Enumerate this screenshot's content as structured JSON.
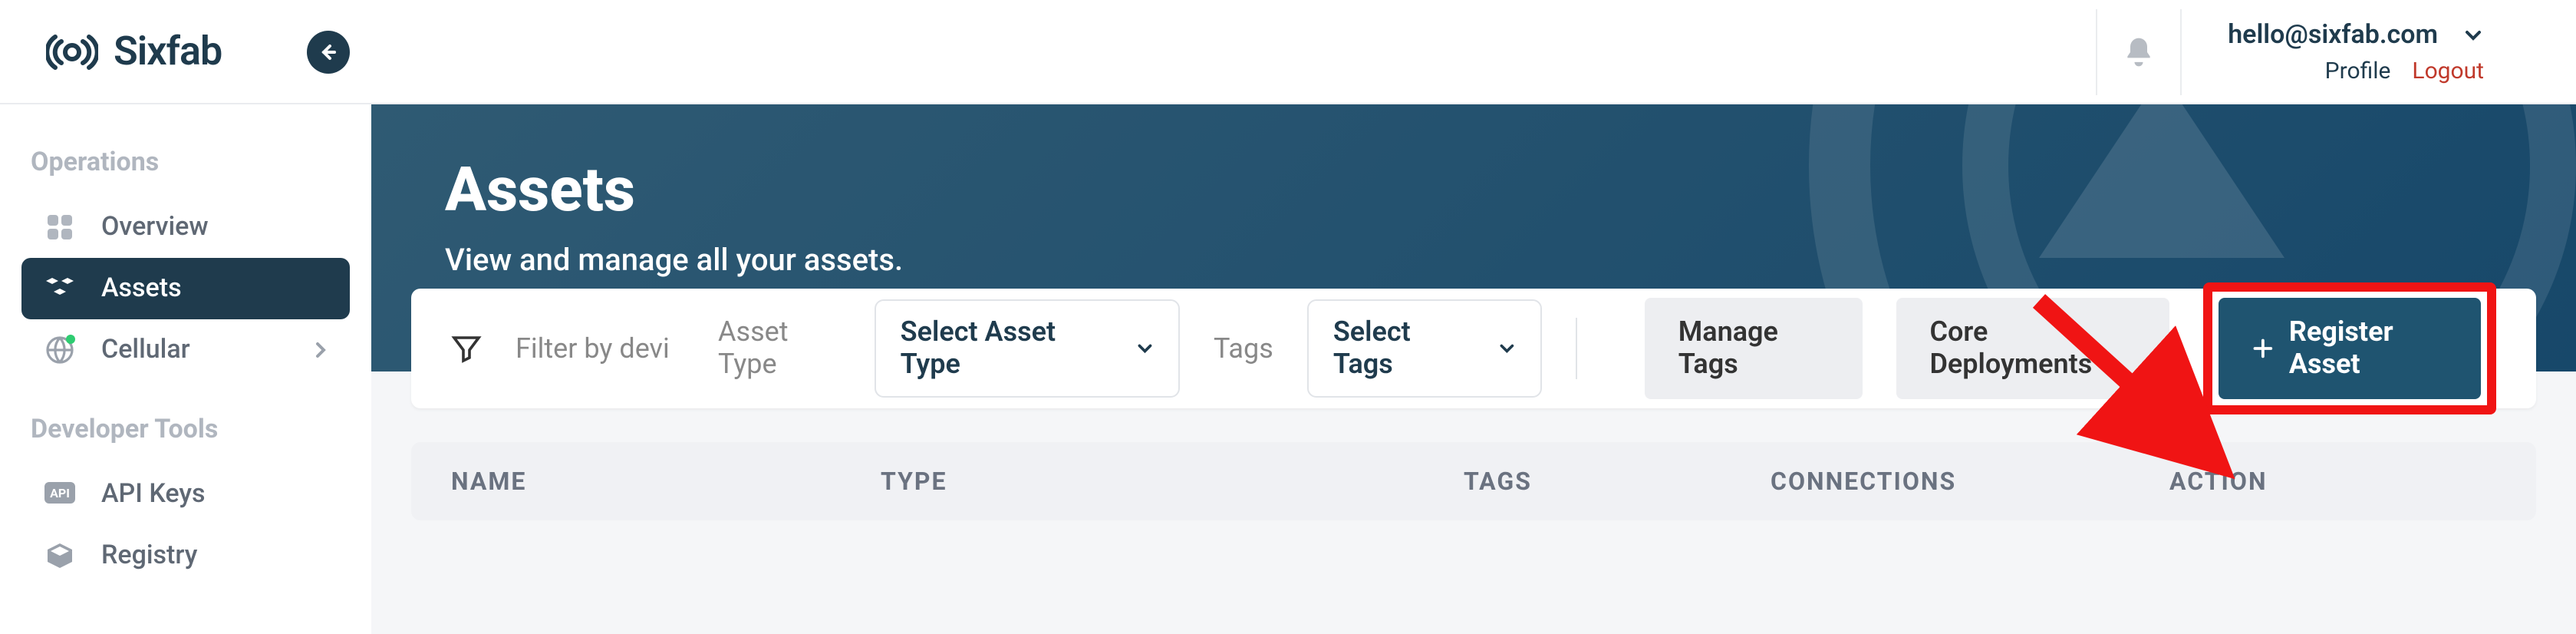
{
  "brand": "Sixfab",
  "header": {
    "user_email": "hello@sixfab.com",
    "profile_label": "Profile",
    "logout_label": "Logout"
  },
  "sidebar": {
    "section1_label": "Operations",
    "section2_label": "Developer Tools",
    "items": {
      "overview": "Overview",
      "assets": "Assets",
      "cellular": "Cellular",
      "apikeys": "API Keys",
      "registry": "Registry"
    }
  },
  "hero": {
    "title": "Assets",
    "subtitle": "View and manage all your assets."
  },
  "toolbar": {
    "filter_placeholder": "Filter by devi",
    "asset_type_label": "Asset Type",
    "asset_type_select": "Select Asset Type",
    "tags_label": "Tags",
    "tags_select": "Select Tags",
    "manage_tags": "Manage Tags",
    "core_deployments": "Core Deployments",
    "register_asset": "Register Asset"
  },
  "table": {
    "cols": {
      "name": "NAME",
      "type": "TYPE",
      "tags": "TAGS",
      "connections": "CONNECTIONS",
      "action": "ACTION"
    }
  }
}
